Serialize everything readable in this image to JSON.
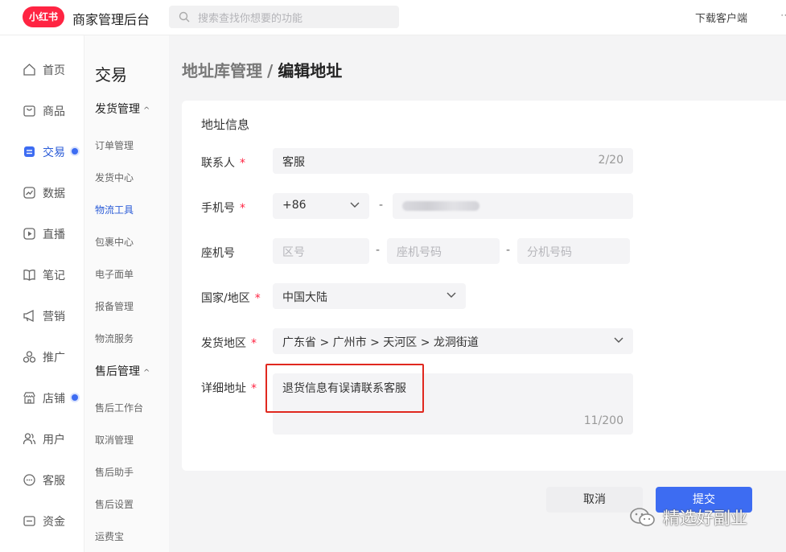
{
  "topbar": {
    "logo_text": "小红书",
    "app_title": "商家管理后台",
    "search_placeholder": "搜索查找你想要的功能",
    "download_label": "下载客户端"
  },
  "nav": {
    "items": [
      {
        "label": "首页",
        "icon": "home-icon"
      },
      {
        "label": "商品",
        "icon": "bag-icon"
      },
      {
        "label": "交易",
        "icon": "trade-icon",
        "active": true,
        "dot": true
      },
      {
        "label": "数据",
        "icon": "chart-icon"
      },
      {
        "label": "直播",
        "icon": "play-icon"
      },
      {
        "label": "笔记",
        "icon": "book-icon"
      },
      {
        "label": "营销",
        "icon": "megaphone-icon"
      },
      {
        "label": "推广",
        "icon": "promote-icon"
      },
      {
        "label": "店铺",
        "icon": "shop-icon",
        "dot": true
      },
      {
        "label": "用户",
        "icon": "users-icon"
      },
      {
        "label": "客服",
        "icon": "chat-icon"
      },
      {
        "label": "资金",
        "icon": "wallet-icon"
      }
    ]
  },
  "subnav": {
    "section_title": "交易",
    "group1": "发货管理",
    "group1_links": [
      "订单管理",
      "发货中心",
      "物流工具",
      "包裹中心",
      "电子面单",
      "报备管理",
      "物流服务"
    ],
    "group2": "售后管理",
    "group2_links": [
      "售后工作台",
      "取消管理",
      "售后助手",
      "售后设置",
      "运费宝"
    ]
  },
  "breadcrumb": {
    "parent": "地址库管理",
    "separator": "/",
    "current": "编辑地址"
  },
  "form": {
    "title": "地址信息",
    "contact_label": "联系人",
    "contact_value": "客服",
    "contact_count": "2/20",
    "phone_label": "手机号",
    "phone_code": "+86",
    "phone_dash": "-",
    "landline_label": "座机号",
    "area_placeholder": "区号",
    "landline_placeholder": "座机号码",
    "ext_placeholder": "分机号码",
    "country_label": "国家/地区",
    "country_value": "中国大陆",
    "region_label": "发货地区",
    "region_value": "广东省 > 广州市 > 天河区 > 龙洞街道",
    "detail_label": "详细地址",
    "detail_value": "退货信息有误请联系客服",
    "detail_count": "11/200",
    "required_mark": "*"
  },
  "actions": {
    "cancel_label": "取消",
    "submit_label": "提交"
  },
  "watermark": {
    "text": "精选好副业"
  },
  "colors": {
    "brand": "#ff2442",
    "primary": "#3d6cf2",
    "highlight_box": "#e0281f"
  }
}
